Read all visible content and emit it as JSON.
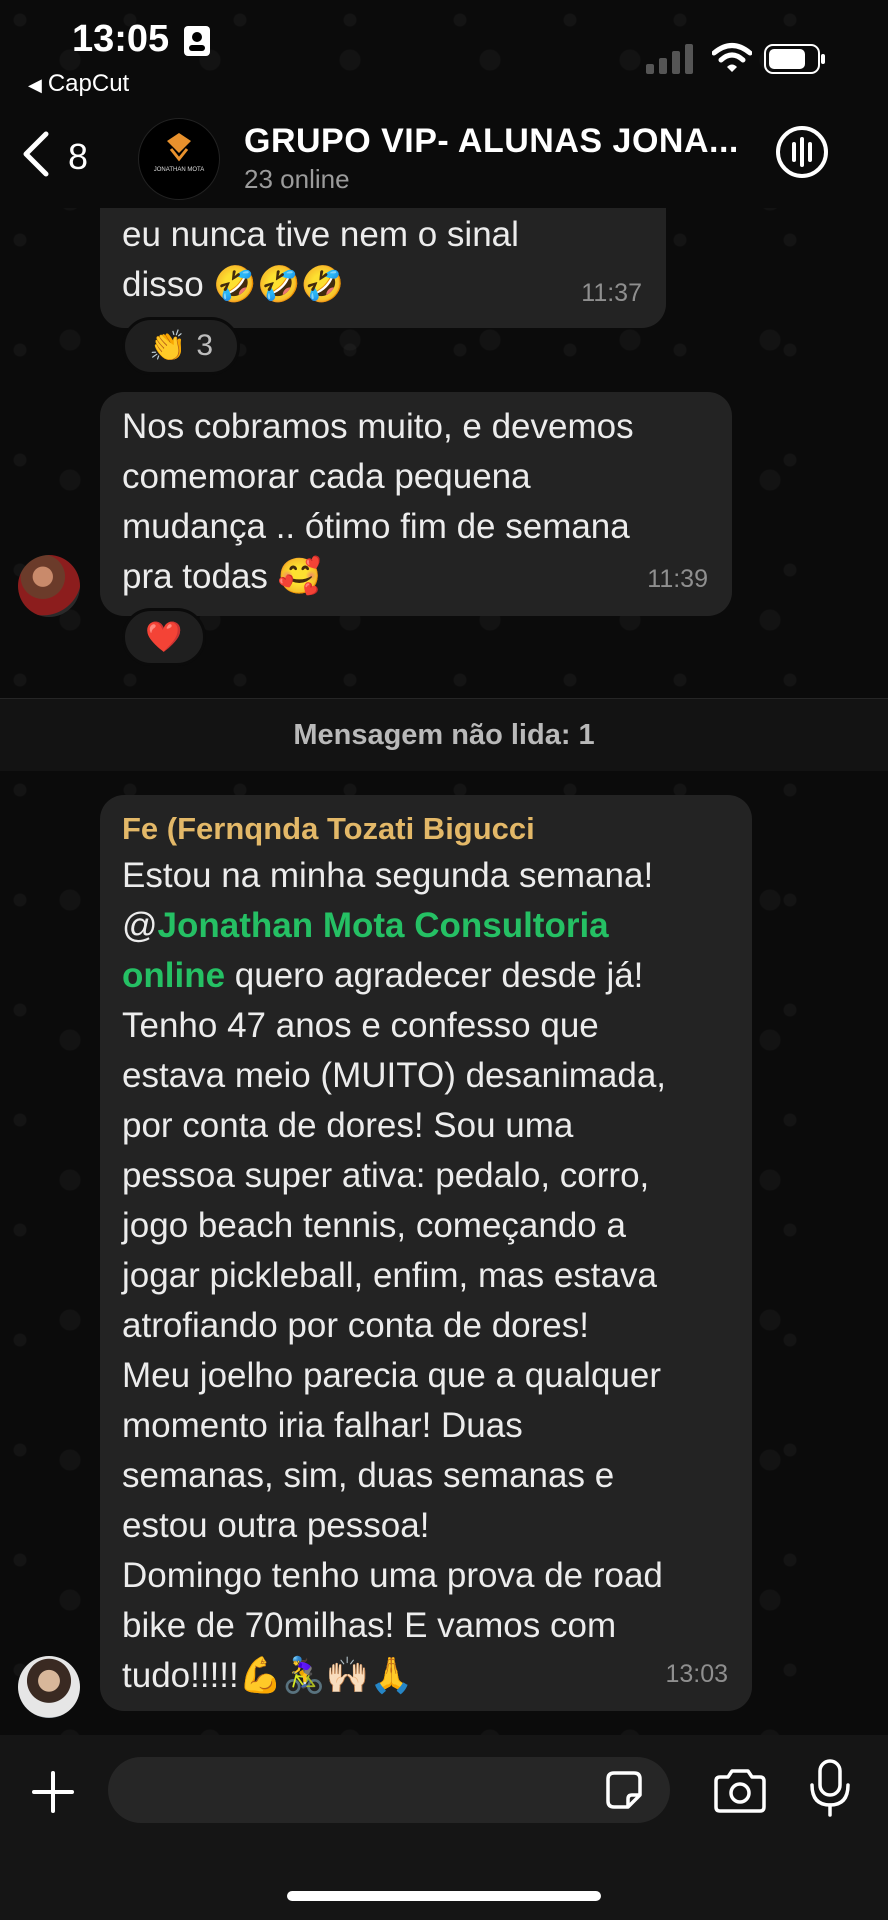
{
  "status_bar": {
    "time": "13:05",
    "back_app": "CapCut"
  },
  "header": {
    "back_count": "8",
    "title": "GRUPO VIP- ALUNAS JONA...",
    "subtitle": "23 online",
    "avatar_logo_text": "JONATHAN MOTA"
  },
  "messages": [
    {
      "text_lines": [
        "eu nunca tive nem  o sinal",
        "disso 🤣🤣🤣"
      ],
      "time": "11:37",
      "reaction": {
        "emoji": "👏",
        "count": "3"
      }
    },
    {
      "text_lines": [
        "Nos cobramos  muito, e devemos",
        "comemorar cada pequena",
        "mudança .. ótimo fim de semana",
        "pra todas 🥰"
      ],
      "time": "11:39",
      "reaction": {
        "emoji": "❤️"
      }
    }
  ],
  "unread_divider": "Mensagem não lida: 1",
  "last_message": {
    "sender": "Fe (Fernqnda Tozati Bigucci",
    "line1": "Estou na minha segunda semana!",
    "mention_at": "@",
    "mention_a": "Jonathan Mota Consultoria",
    "mention_b": "online",
    "after_mention": " quero agradecer desde já!",
    "rest_lines": [
      "Tenho 47 anos e confesso que",
      "estava meio (MUITO) desanimada,",
      "por conta de dores! Sou uma",
      "pessoa super ativa: pedalo, corro,",
      "jogo beach tennis, começando a",
      "jogar pickleball, enfim, mas estava",
      "atrofiando por conta de dores!",
      "Meu joelho parecia que a qualquer",
      "momento iria falhar! Duas",
      "semanas, sim, duas semanas e",
      "estou outra pessoa!",
      "Domingo tenho uma prova de road",
      "bike de 70milhas! E vamos com",
      "tudo!!!!!💪🚴‍♀️🙌🏻🙏"
    ],
    "time": "13:03"
  },
  "composer": {
    "placeholder": ""
  },
  "icons": {
    "back": "chevron-left-icon",
    "call": "voice-call-icon",
    "plus": "plus-icon",
    "sticker": "sticker-icon",
    "camera": "camera-icon",
    "mic": "microphone-icon"
  },
  "colors": {
    "background": "#0b0b0b",
    "bubble": "#232323",
    "sender_name": "#e3b868",
    "mention": "#25c064",
    "timestamp": "#8f8f8f"
  }
}
